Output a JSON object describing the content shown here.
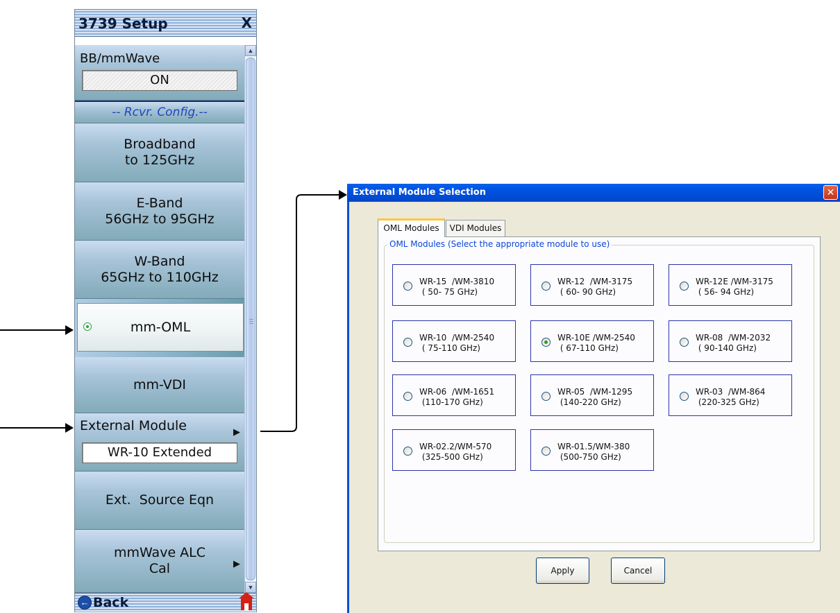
{
  "menu": {
    "title": "3739 Setup",
    "close": "X",
    "bb_label": "BB/mmWave",
    "bb_value": "ON",
    "rcvr_header": "-- Rcvr. Config.--",
    "broadband": [
      "Broadband",
      "to 125GHz"
    ],
    "eband": [
      "E-Band",
      "56GHz to 95GHz"
    ],
    "wband": [
      "W-Band",
      "65GHz to 110GHz"
    ],
    "oml": "mm-OML",
    "vdi": "mm-VDI",
    "ext_label": "External Module",
    "ext_value": "WR-10 Extended",
    "ext_source": "Ext.  Source Eqn",
    "alc": [
      "mmWave ALC",
      "Cal"
    ],
    "back": "Back",
    "scroll_up": "▲",
    "scroll_down": "▼",
    "submenu_arrow": "▶",
    "back_icon": "arrow-left-icon",
    "home_icon": "home-icon"
  },
  "dialog": {
    "title": "External Module Selection",
    "close": "✕",
    "tabs": [
      "OML Modules",
      "VDI Modules"
    ],
    "group_label": "OML Modules (Select the appropriate module to use)",
    "modules": [
      {
        "line1": "WR-15  /WM-3810",
        "line2": " ( 50- 75 GHz)",
        "selected": false
      },
      {
        "line1": "WR-12  /WM-3175",
        "line2": " ( 60- 90 GHz)",
        "selected": false
      },
      {
        "line1": "WR-12E /WM-3175",
        "line2": " ( 56- 94 GHz)",
        "selected": false
      },
      {
        "line1": "WR-10  /WM-2540",
        "line2": " ( 75-110 GHz)",
        "selected": false
      },
      {
        "line1": "WR-10E /WM-2540",
        "line2": " ( 67-110 GHz)",
        "selected": true
      },
      {
        "line1": "WR-08  /WM-2032",
        "line2": " ( 90-140 GHz)",
        "selected": false
      },
      {
        "line1": "WR-06  /WM-1651",
        "line2": " (110-170 GHz)",
        "selected": false
      },
      {
        "line1": "WR-05  /WM-1295",
        "line2": " (140-220 GHz)",
        "selected": false
      },
      {
        "line1": "WR-03  /WM-864",
        "line2": " (220-325 GHz)",
        "selected": false
      },
      {
        "line1": "WR-02.2/WM-570",
        "line2": " (325-500 GHz)",
        "selected": false
      },
      {
        "line1": "WR-01.5/WM-380",
        "line2": " (500-750 GHz)",
        "selected": false
      }
    ],
    "apply": "Apply",
    "cancel": "Cancel"
  },
  "colors": {
    "dialog_bg": "#ece9d8",
    "titlebar_blue": "#0054e3",
    "module_border": "#2a33a8",
    "radio_selected": "#21a121",
    "rcvr_text": "#1e47b8"
  }
}
